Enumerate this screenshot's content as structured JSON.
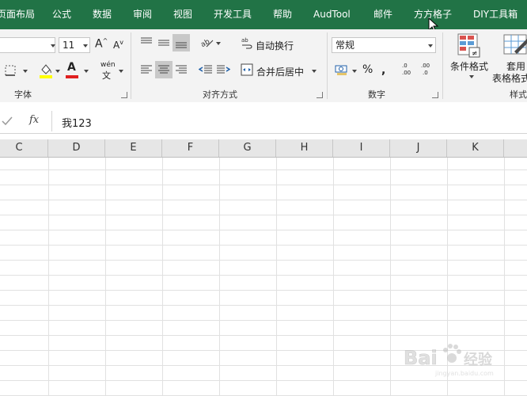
{
  "tabs": [
    "页面布局",
    "公式",
    "数据",
    "审阅",
    "视图",
    "开发工具",
    "帮助",
    "AudTool",
    "邮件",
    "方方格子",
    "DIY工具箱"
  ],
  "font_group": {
    "label": "字体",
    "size": "11",
    "grow": "A",
    "shrink": "A",
    "phonetic": "wén"
  },
  "align_group": {
    "label": "对齐方式",
    "wrap_text": "自动换行",
    "merge_center": "合并后居中"
  },
  "number_group": {
    "label": "数字",
    "format": "常规",
    "percent": "%",
    "inc_decimal": ".00",
    "dec_decimal": ".0"
  },
  "styles_group": {
    "label": "样式",
    "conditional": "条件格式",
    "table_format_line1": "套用",
    "table_format_line2": "表格格式"
  },
  "formula_bar": {
    "fx": "fx",
    "content": "我123"
  },
  "columns": [
    "C",
    "D",
    "E",
    "F",
    "G",
    "H",
    "I",
    "J",
    "K"
  ],
  "watermark": {
    "text": "Bai",
    "text2": "经验",
    "sub": "jingyan.baidu.com"
  },
  "colors": {
    "ribbon_green": "#217346",
    "font_red": "#e02020",
    "fill_yellow": "#ffff00"
  }
}
